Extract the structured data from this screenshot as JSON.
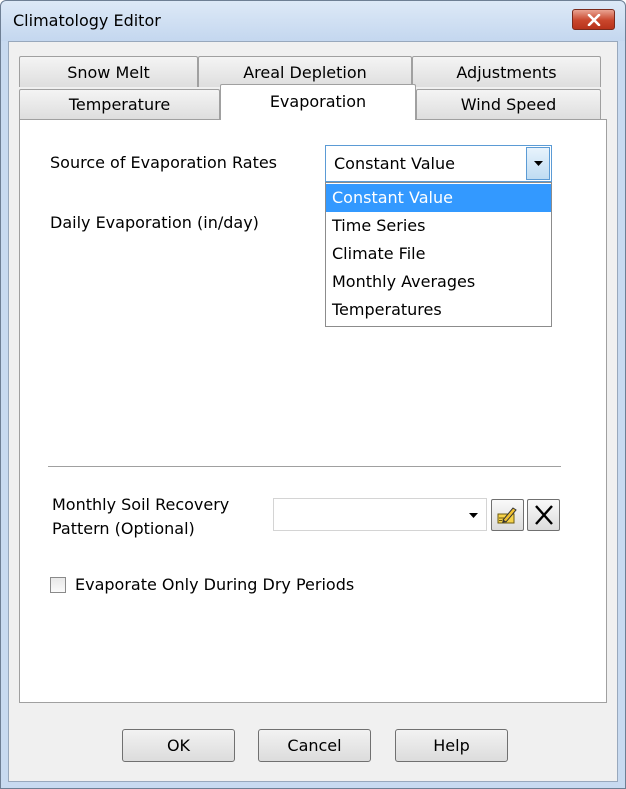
{
  "window": {
    "title": "Climatology Editor"
  },
  "tabs": {
    "row_back": [
      "Snow Melt",
      "Areal Depletion",
      "Adjustments"
    ],
    "row_front": [
      "Temperature",
      "Evaporation",
      "Wind Speed"
    ],
    "active": "Evaporation"
  },
  "evaporation": {
    "source_label": "Source of Evaporation  Rates",
    "source_value": "Constant Value",
    "source_options": [
      "Constant Value",
      "Time Series",
      "Climate File",
      "Monthly Averages",
      "Temperatures"
    ],
    "daily_label": "Daily Evaporation (in/day)",
    "soil_label_line1": "Monthly Soil Recovery",
    "soil_label_line2": "Pattern (Optional)",
    "soil_value": "",
    "dry_periods_label": "Evaporate Only During Dry Periods",
    "dry_periods_checked": false
  },
  "buttons": {
    "ok": "OK",
    "cancel": "Cancel",
    "help": "Help"
  },
  "icons": {
    "close": "close-icon",
    "dropdown": "chevron-down-icon",
    "edit": "pencil-edit-icon",
    "delete": "x-delete-icon"
  },
  "colors": {
    "selection": "#3399ff",
    "close_button": "#c9462c",
    "frame": "#c8daf0"
  }
}
